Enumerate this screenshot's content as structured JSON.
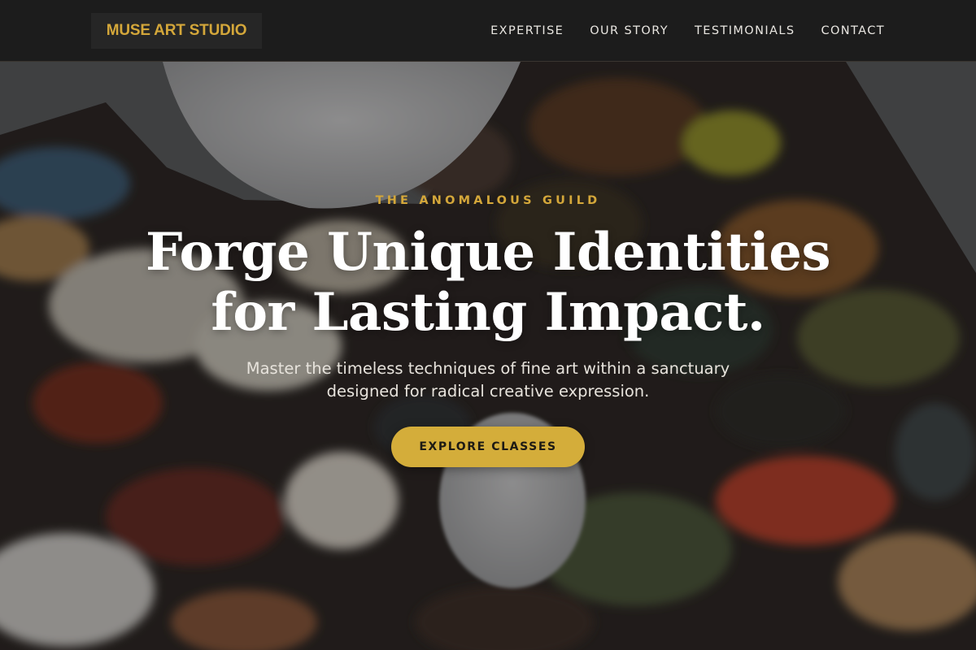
{
  "brand": {
    "logo_text": "MUSE ART STUDIO",
    "accent_color": "#d4a73a"
  },
  "nav": {
    "items": [
      {
        "label": "EXPERTISE"
      },
      {
        "label": "OUR STORY"
      },
      {
        "label": "TESTIMONIALS"
      },
      {
        "label": "CONTACT"
      }
    ]
  },
  "hero": {
    "eyebrow": "THE ANOMALOUS GUILD",
    "headline_line1": "Forge Unique Identities",
    "headline_line2": "for Lasting Impact.",
    "subtext": "Master the timeless techniques of fine art within a sanctuary designed for radical creative expression.",
    "cta_label": "EXPLORE CLASSES",
    "background_image": "paint-palette-photo"
  }
}
